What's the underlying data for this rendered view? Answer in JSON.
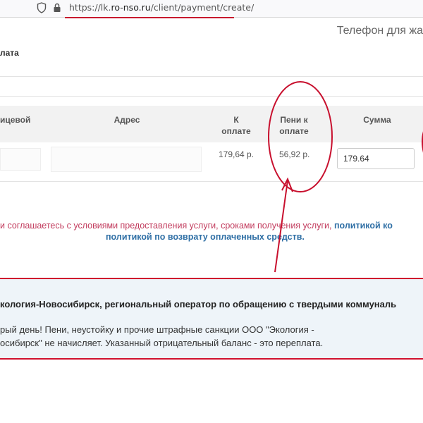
{
  "browser": {
    "url_prefix": "https://lk.",
    "url_domain": "ro-nso.ru",
    "url_path": "/client/payment/create/"
  },
  "header": {
    "phone_label": "Телефон для жа"
  },
  "section": {
    "title": "лата"
  },
  "table": {
    "headers": {
      "account": "ицевой",
      "address": "Адрес",
      "to_pay_l1": "К",
      "to_pay_l2": "оплате",
      "fines_l1": "Пени к",
      "fines_l2": "оплате",
      "sum": "Сумма"
    },
    "row": {
      "to_pay": "179,64 р.",
      "fines": "56,92 р.",
      "sum_value": "179.64"
    }
  },
  "agreement": {
    "part1": "и соглашаетесь с условиями предоставления услуги, сроками получения услуги,",
    "link1": "политикой ко",
    "link2": "политикой по возврату оплаченных средств."
  },
  "message": {
    "title": "кология-Новосибирск, региональный оператор по обращению с твердыми коммуналь",
    "line1": "рый день! Пени, неустойку и прочие штрафные санкции ООО \"Экология -",
    "line2": "осибирск\" не начисляет. Указанный отрицательный баланс - это переплата."
  },
  "colors": {
    "annotation_red": "#c8102e",
    "link_blue": "#2f6fa5",
    "agree_red": "#c23b5d",
    "message_bg": "#eef4f9"
  }
}
